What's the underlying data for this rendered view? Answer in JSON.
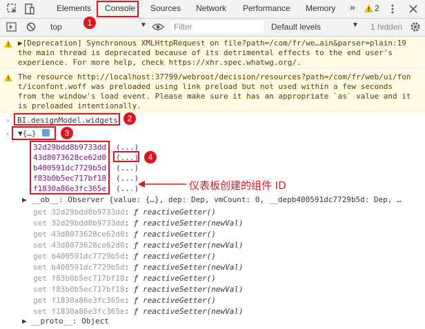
{
  "tabs": [
    "Elements",
    "Console",
    "Sources",
    "Network",
    "Performance",
    "Memory"
  ],
  "more_glyph": "»",
  "warn_count": "2",
  "toolbar": {
    "context": "top",
    "filter_placeholder": "Filter",
    "levels": "Default levels",
    "hidden": "1 hidden"
  },
  "warnings": [
    [
      "▶[Deprecation] Synchronous XMLHttpRequest on file?path=/com/fr/we…ain&parser=plain:19",
      "the main thread is deprecated because of its detrimental effects to the end user's",
      "experience. For more help, check https://xhr.spec.whatwg.org/."
    ],
    [
      "The resource http://localhost:37799/webroot/decision/resources?path=/com/fr/web/ui/fon",
      "t/iconfont.woff was preloaded using link preload but not used within a few seconds",
      "from the window's load event. Please make sure it has an appropriate `as` value and it",
      "is preloaded intentionally."
    ]
  ],
  "command": "BI.designModel.widgets",
  "object_summary": "▼{…}",
  "ids": [
    "32d29bdd8b9733dd",
    "43d8073628ce62d0",
    "b400591dc7729b5d",
    "f83b0b5ec717bf18",
    "f1830a86e3fc365e"
  ],
  "lazy": "(...)",
  "ob_line": "▶ __ob__: Observer {value: {…}, dep: Dep, vmCount: 0, __depb400591dc7729b5d: Dep, …",
  "accessors": [
    {
      "kind": "get",
      "id": "32d29bdd8b9733dd",
      "fn": "reactiveGetter()"
    },
    {
      "kind": "set",
      "id": "32d29bdd8b9733dd",
      "fn": "reactiveSetter(newVal)"
    },
    {
      "kind": "get",
      "id": "43d8073628ce62d0",
      "fn": "reactiveGetter()"
    },
    {
      "kind": "set",
      "id": "43d8073628ce62d0",
      "fn": "reactiveSetter(newVal)"
    },
    {
      "kind": "get",
      "id": "b400591dc7729b5d",
      "fn": "reactiveGetter()"
    },
    {
      "kind": "set",
      "id": "b400591dc7729b5d",
      "fn": "reactiveSetter(newVal)"
    },
    {
      "kind": "get",
      "id": "f83b0b5ec717bf18",
      "fn": "reactiveGetter()"
    },
    {
      "kind": "set",
      "id": "f83b0b5ec717bf18",
      "fn": "reactiveSetter(newVal)"
    },
    {
      "kind": "get",
      "id": "f1830a86e3fc365e",
      "fn": "reactiveGetter()"
    },
    {
      "kind": "set",
      "id": "f1830a86e3fc365e",
      "fn": "reactiveSetter(newVal)"
    }
  ],
  "proto_line": "▶ __proto__: Object",
  "annotation": "仪表板创建的组件 ID",
  "badges": [
    "1",
    "2",
    "3",
    "4"
  ],
  "colors": {
    "accent": "#e0141e",
    "warning_bg": "#fffbe5",
    "key": "#881391"
  }
}
